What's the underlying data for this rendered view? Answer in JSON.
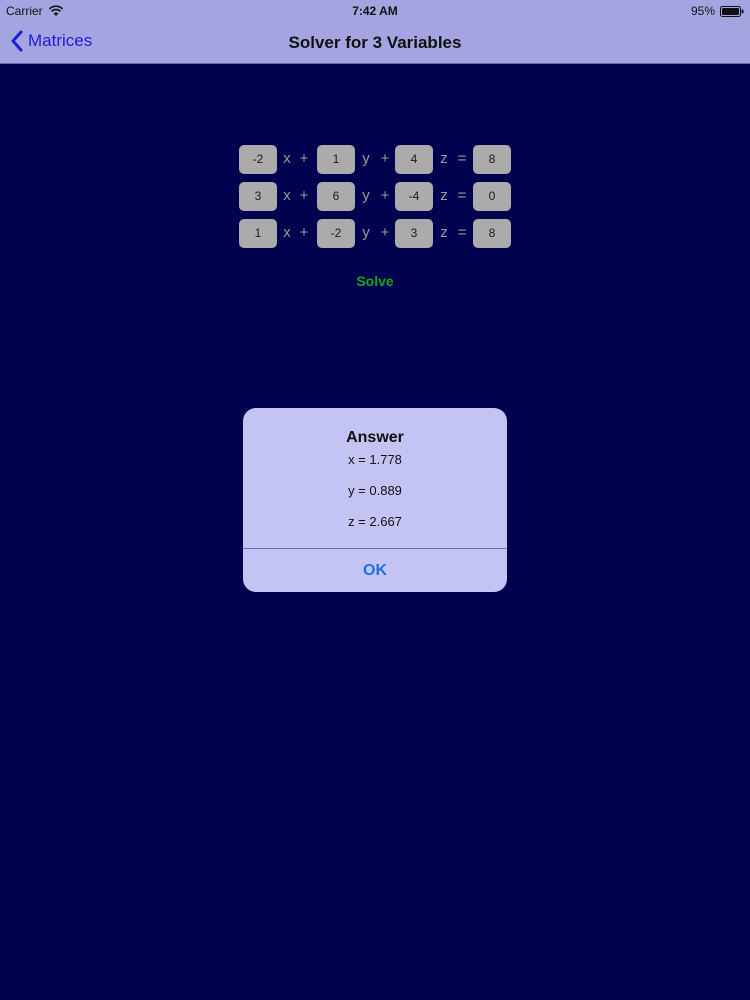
{
  "status_bar": {
    "carrier": "Carrier",
    "time": "7:42 AM",
    "battery": "95%",
    "wifi_icon": "wifi-icon",
    "battery_icon": "battery-icon"
  },
  "nav": {
    "back_label": "Matrices",
    "back_icon": "chevron-left-icon",
    "title": "Solver for 3 Variables"
  },
  "equations": {
    "variables": [
      "x",
      "y",
      "z"
    ],
    "rows": [
      {
        "a": "-2",
        "b": "1",
        "c": "4",
        "result": "8"
      },
      {
        "a": "3",
        "b": "6",
        "c": "-4",
        "result": "0"
      },
      {
        "a": "1",
        "b": "-2",
        "c": "3",
        "result": "8"
      }
    ],
    "plus": "+",
    "equals": "="
  },
  "solve_label": "Solve",
  "alert": {
    "title": "Answer",
    "lines": [
      "x = 1.778",
      "y = 0.889",
      "z = 2.667"
    ],
    "ok_label": "OK"
  },
  "colors": {
    "background": "#00024f",
    "bar": "#a4a4e0",
    "accent_back": "#1d1ddb",
    "solve": "#19a419",
    "alert_bg": "#c4c4f4",
    "ok": "#1f6fe0"
  }
}
